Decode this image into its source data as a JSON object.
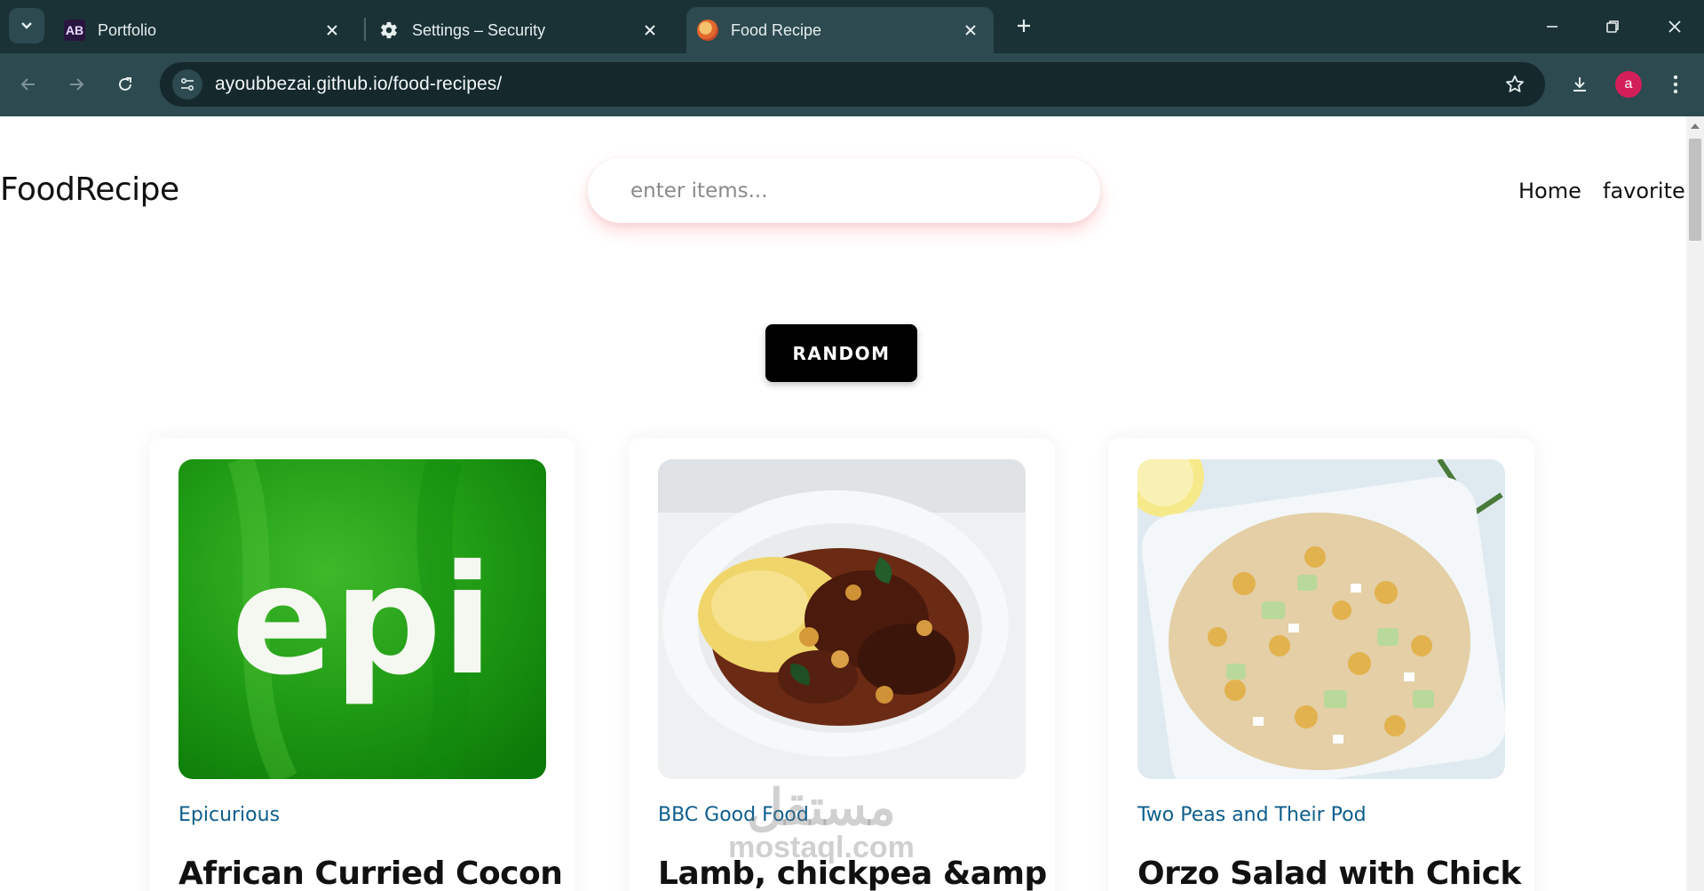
{
  "browser": {
    "tabs": [
      {
        "title": "Portfolio",
        "favicon": "ab-logo-icon"
      },
      {
        "title": "Settings – Security",
        "favicon": "gear-icon"
      },
      {
        "title": "Food Recipe",
        "favicon": "food-plate-icon",
        "active": true
      }
    ],
    "url": "ayoubbezai.github.io/food-recipes/",
    "avatar_letter": "a",
    "colors": {
      "frame": "#1a3236",
      "toolbar": "#2c4a4f",
      "omnibox": "#15292d",
      "avatar": "#d21f5a"
    }
  },
  "header": {
    "brand": "FoodRecipe",
    "search_placeholder": "enter items...",
    "nav": [
      "Home",
      "favorites"
    ]
  },
  "random_button": "RANDOM",
  "cards": [
    {
      "source": "Epicurious",
      "title": "African Curried Cocon",
      "image": "epi-logo"
    },
    {
      "source": "BBC Good Food",
      "title": "Lamb, chickpea &amp",
      "image": "lamb-chickpea-stew"
    },
    {
      "source": "Two Peas and Their Pod",
      "title": "Orzo Salad with Chick",
      "image": "orzo-salad"
    }
  ],
  "watermark": {
    "arabic": "مستقل",
    "latin": "mostaql.com"
  },
  "colors": {
    "source_link": "#0d5e8c",
    "button": "#000000"
  }
}
